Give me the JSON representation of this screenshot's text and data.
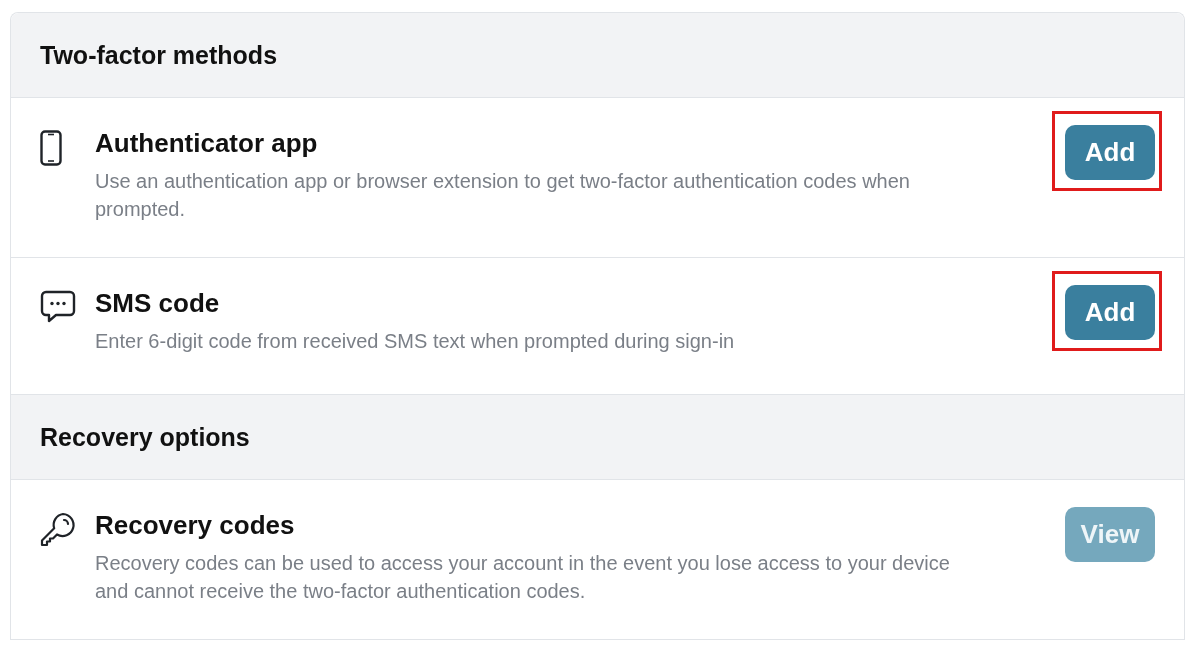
{
  "sections": [
    {
      "title": "Two-factor methods",
      "items": [
        {
          "kind": "phone",
          "title": "Authenticator app",
          "description": "Use an authentication app or browser extension to get two-factor authentication codes when prompted.",
          "button": {
            "label": "Add",
            "disabled": false,
            "highlighted": true
          }
        },
        {
          "kind": "chat",
          "title": "SMS code",
          "description": "Enter 6-digit code from received SMS text when prompted during sign-in",
          "button": {
            "label": "Add",
            "disabled": false,
            "highlighted": true
          }
        }
      ]
    },
    {
      "title": "Recovery options",
      "items": [
        {
          "kind": "key",
          "title": "Recovery codes",
          "description": "Recovery codes can be used to access your account in the event you lose access to your device and cannot receive the two-factor authentication codes.",
          "button": {
            "label": "View",
            "disabled": true,
            "highlighted": false
          }
        }
      ]
    }
  ]
}
